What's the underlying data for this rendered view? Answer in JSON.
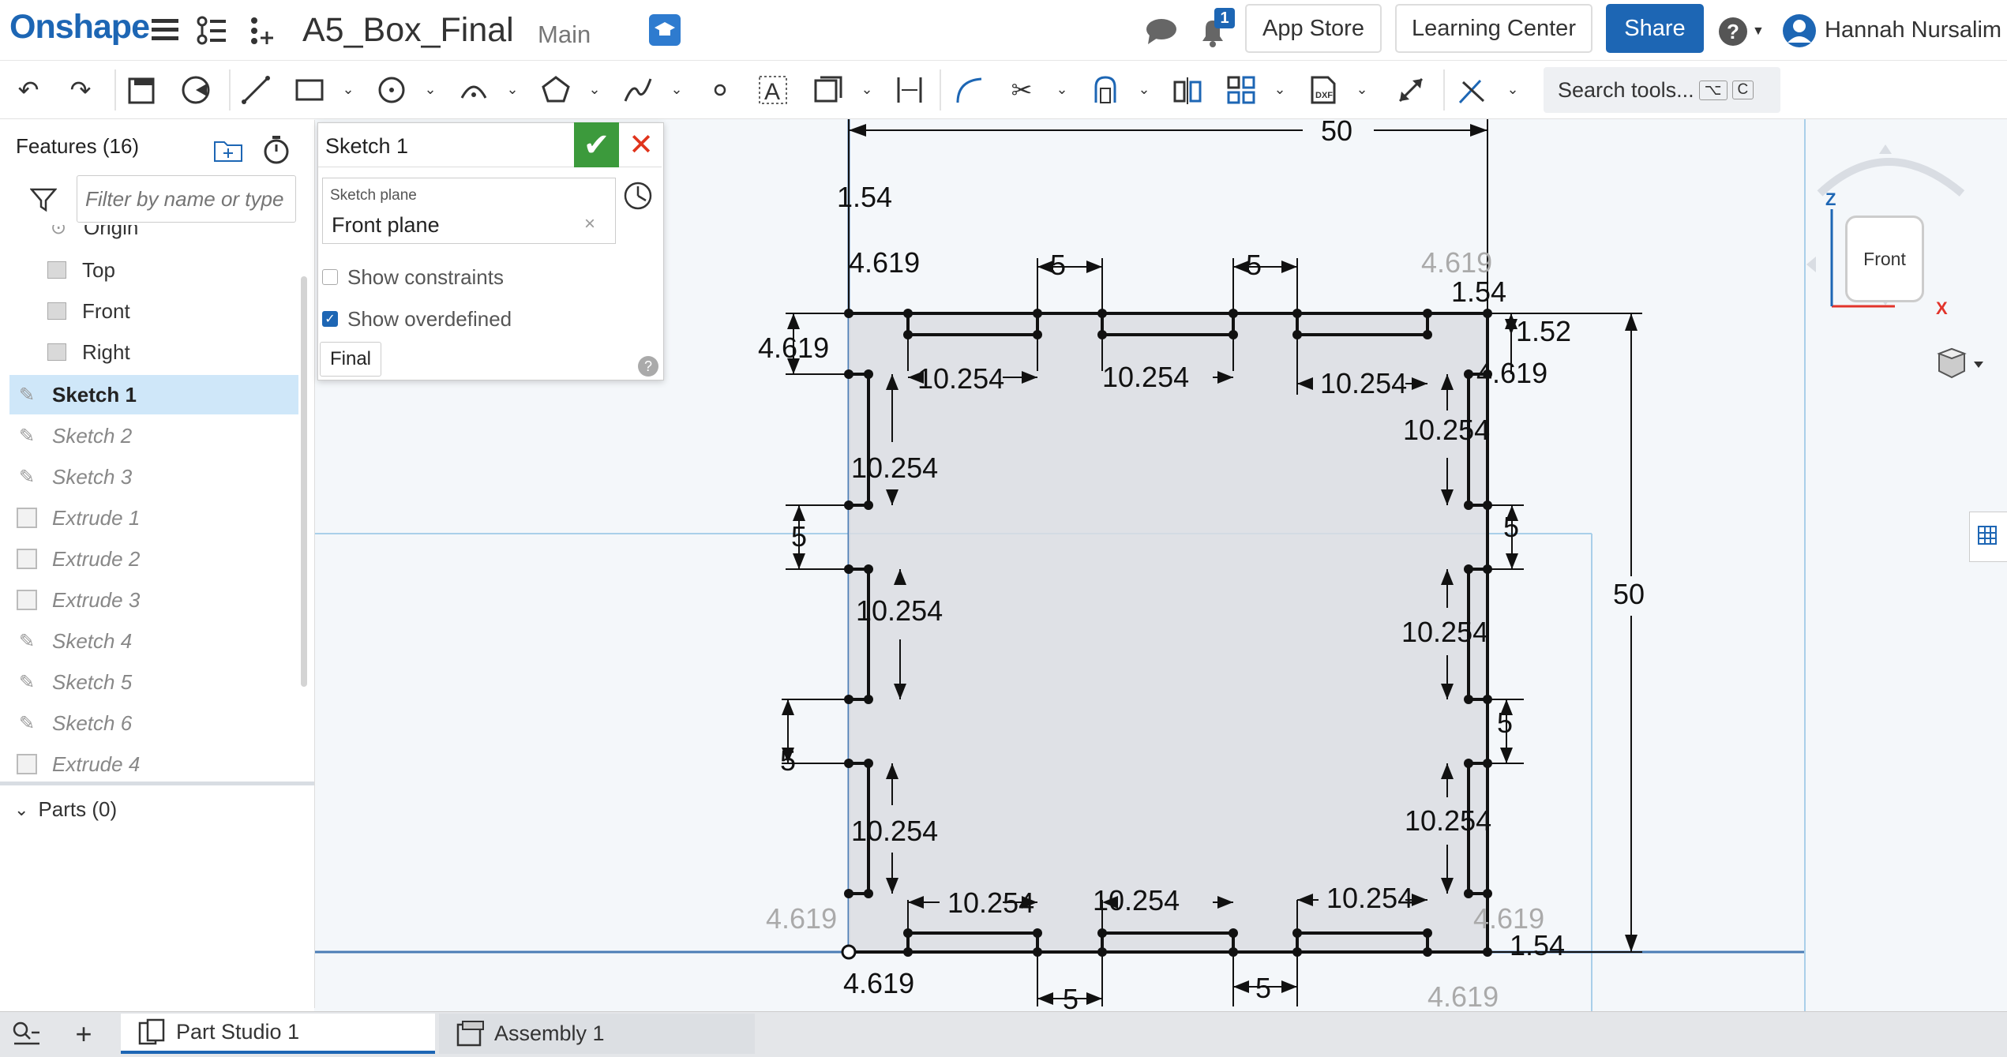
{
  "app": {
    "logo": "Onshape",
    "document_title": "A5_Box_Final",
    "branch": "Main"
  },
  "topbar": {
    "notification_count": "1",
    "app_store": "App Store",
    "learning_center": "Learning Center",
    "share": "Share",
    "help": "?",
    "user_name": "Hannah Nursalim"
  },
  "toolbar": {
    "search_label": "Search tools...",
    "shortcut_1": "⌥",
    "shortcut_2": "C"
  },
  "features": {
    "header": "Features (16)",
    "filter_placeholder": "Filter by name or type",
    "items": [
      {
        "label": "Origin"
      },
      {
        "label": "Top"
      },
      {
        "label": "Front"
      },
      {
        "label": "Right"
      },
      {
        "label": "Sketch 1"
      },
      {
        "label": "Sketch 2"
      },
      {
        "label": "Sketch 3"
      },
      {
        "label": "Extrude 1"
      },
      {
        "label": "Extrude 2"
      },
      {
        "label": "Extrude 3"
      },
      {
        "label": "Sketch 4"
      },
      {
        "label": "Sketch 5"
      },
      {
        "label": "Sketch 6"
      },
      {
        "label": "Extrude 4"
      }
    ],
    "parts_header": "Parts (0)"
  },
  "sketch_dialog": {
    "title": "Sketch 1",
    "plane_label": "Sketch plane",
    "plane_value": "Front plane",
    "show_constraints": "Show constraints",
    "show_constraints_checked": false,
    "show_overdefined": "Show overdefined",
    "show_overdefined_checked": true,
    "final_button": "Final"
  },
  "viewcube": {
    "face": "Front",
    "axis_z": "Z",
    "axis_x": "X"
  },
  "sketch_dimensions": {
    "overall_width": "50",
    "overall_height": "50",
    "d_1_54": "1.54",
    "d_1_52": "1.52",
    "d_4_619": "4.619",
    "d_5": "5",
    "d_10_254": "10.254"
  },
  "tabs": [
    {
      "label": "Part Studio 1",
      "active": true
    },
    {
      "label": "Assembly 1",
      "active": false
    }
  ]
}
